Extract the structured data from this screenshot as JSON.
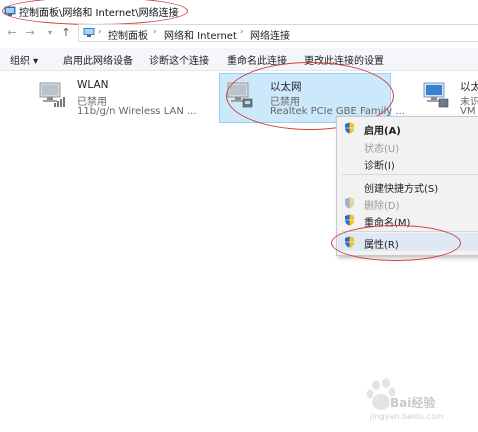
{
  "window": {
    "title": "控制面板\\网络和 Internet\\网络连接"
  },
  "address_bar": {
    "crumbs": [
      "控制面板",
      "网络和 Internet",
      "网络连接"
    ]
  },
  "toolbar": {
    "items": [
      "组织 ▾",
      "启用此网络设备",
      "诊断这个连接",
      "重命名此连接",
      "更改此连接的设置"
    ]
  },
  "adapters": [
    {
      "name": "WLAN",
      "status": "已禁用",
      "desc": "11b/g/n  Wireless LAN ..."
    },
    {
      "name": "以太网",
      "status": "已禁用",
      "desc": "Realtek PCIe GBE Family ..."
    },
    {
      "name": "以太",
      "status": "未识",
      "desc": "VM"
    }
  ],
  "context_menu": {
    "items": [
      {
        "label": "启用(A)",
        "disabled": false,
        "bold": true,
        "shield": true
      },
      {
        "label": "状态(U)",
        "disabled": true,
        "shield": false
      },
      {
        "label": "诊断(I)",
        "disabled": false,
        "shield": false
      },
      {
        "label": "创建快捷方式(S)",
        "disabled": false,
        "shield": false
      },
      {
        "label": "删除(D)",
        "disabled": true,
        "shield": true
      },
      {
        "label": "重命名(M)",
        "disabled": false,
        "shield": true
      },
      {
        "label": "属性(R)",
        "disabled": false,
        "shield": true,
        "highlighted": true
      }
    ]
  },
  "watermark": {
    "brand": "Bai经验",
    "url": "jingyan.baidu.com"
  },
  "colors": {
    "selection_bg": "#cce8fb",
    "selection_border": "#99d1f7",
    "annotation_red": "#d04040",
    "menu_bg": "#f2f2f2"
  }
}
